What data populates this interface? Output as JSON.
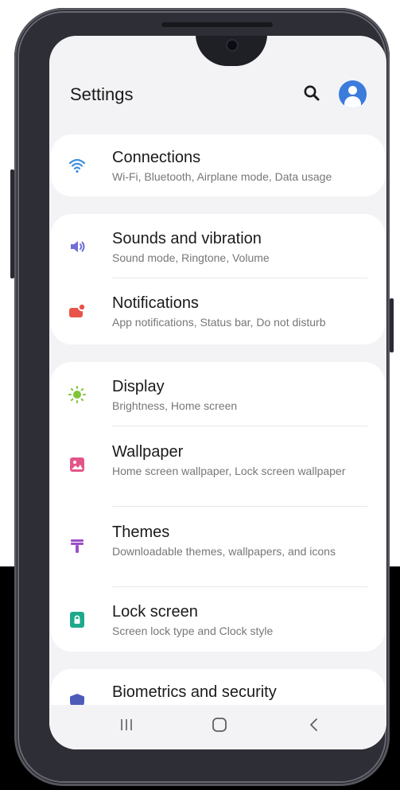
{
  "header": {
    "title": "Settings"
  },
  "sections": [
    {
      "items": [
        {
          "title": "Connections",
          "subtitle": "Wi-Fi, Bluetooth, Airplane mode, Data usage"
        }
      ]
    },
    {
      "items": [
        {
          "title": "Sounds and vibration",
          "subtitle": "Sound mode, Ringtone, Volume"
        },
        {
          "title": "Notifications",
          "subtitle": "App notifications, Status bar, Do not disturb"
        }
      ]
    },
    {
      "items": [
        {
          "title": "Display",
          "subtitle": "Brightness, Home screen"
        },
        {
          "title": "Wallpaper",
          "subtitle": "Home screen wallpaper, Lock screen wallpaper"
        },
        {
          "title": "Themes",
          "subtitle": "Downloadable themes, wallpapers, and icons"
        },
        {
          "title": "Lock screen",
          "subtitle": "Screen lock type and Clock style"
        }
      ]
    },
    {
      "items": [
        {
          "title": "Biometrics and security"
        }
      ]
    }
  ],
  "icons": {
    "connections": "wifi-icon",
    "sounds": "speaker-icon",
    "notifications": "notification-icon",
    "display": "sun-icon",
    "wallpaper": "image-icon",
    "themes": "paintbrush-icon",
    "lock_screen": "lock-icon",
    "biometrics": "shield-icon"
  },
  "colors": {
    "accent": "#3b7bdc",
    "wifi": "#3d8fe0",
    "sounds": "#6f6fd6",
    "notifications": "#e8544a",
    "display": "#7fc53a",
    "wallpaper": "#e25588",
    "themes": "#9a4fc6",
    "lock_screen": "#1fa98c",
    "biometrics": "#4e5bb8"
  }
}
